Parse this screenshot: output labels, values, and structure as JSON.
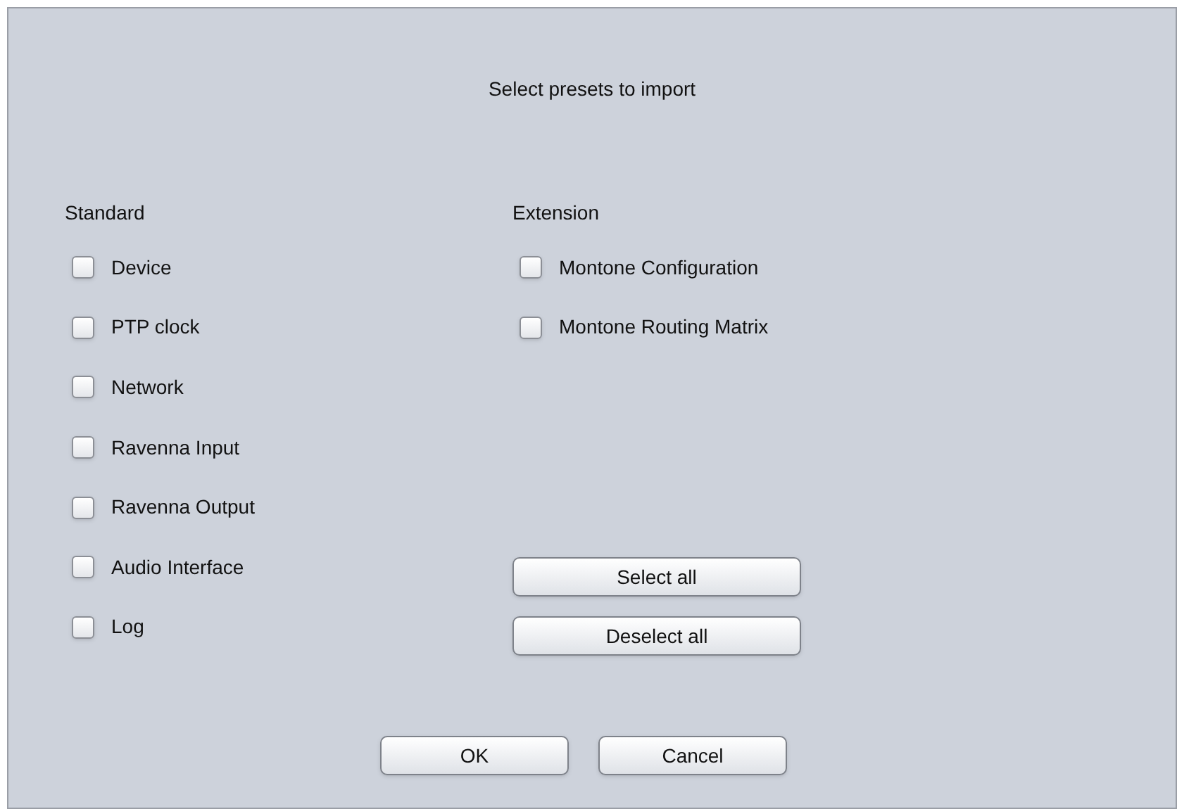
{
  "title": "Select presets to import",
  "groups": [
    {
      "heading": "Standard",
      "items": [
        {
          "label": "Device",
          "checked": false
        },
        {
          "label": "PTP clock",
          "checked": false
        },
        {
          "label": "Network",
          "checked": false
        },
        {
          "label": "Ravenna Input",
          "checked": false
        },
        {
          "label": "Ravenna Output",
          "checked": false
        },
        {
          "label": "Audio Interface",
          "checked": false
        },
        {
          "label": "Log",
          "checked": false
        }
      ]
    },
    {
      "heading": "Extension",
      "items": [
        {
          "label": "Montone Configuration",
          "checked": false
        },
        {
          "label": "Montone Routing Matrix",
          "checked": false
        }
      ]
    }
  ],
  "selection_buttons": [
    "Select all",
    "Deselect all"
  ],
  "buttons": [
    "OK",
    "Cancel"
  ]
}
